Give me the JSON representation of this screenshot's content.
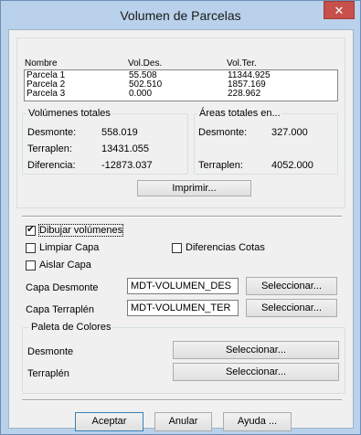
{
  "window": {
    "title": "Volumen de Parcelas",
    "close_glyph": "✕"
  },
  "table": {
    "headers": [
      "Nombre",
      "Vol.Des.",
      "Vol.Ter."
    ],
    "rows": [
      [
        "Parcela 1",
        "55.508",
        "11344.925"
      ],
      [
        "Parcela 2",
        "502.510",
        "1857.169"
      ],
      [
        "Parcela 3",
        "0.000",
        "228.962"
      ]
    ]
  },
  "volumes": {
    "title": "Volúmenes totales",
    "desmonte_label": "Desmonte:",
    "desmonte_value": "558.019",
    "terraplen_label": "Terraplen:",
    "terraplen_value": "13431.055",
    "diferencia_label": "Diferencia:",
    "diferencia_value": "-12873.037"
  },
  "areas": {
    "title": "Áreas totales en...",
    "desmonte_label": "Desmonte:",
    "desmonte_value": "327.000",
    "terraplen_label": "Terraplen:",
    "terraplen_value": "4052.000"
  },
  "imprimir_label": "Imprimir...",
  "options": {
    "dibujar": {
      "label": "Dibujar volúmenes",
      "checked": true
    },
    "limpiar": {
      "label": "Limpiar Capa",
      "checked": false
    },
    "diferencias": {
      "label": "Diferencias Cotas",
      "checked": false
    },
    "aislar": {
      "label": "Aislar Capa",
      "checked": false
    }
  },
  "capa_desmonte": {
    "label": "Capa Desmonte",
    "value": "MDT-VOLUMEN_DES",
    "button": "Seleccionar..."
  },
  "capa_terraplen": {
    "label": "Capa Terraplén",
    "value": "MDT-VOLUMEN_TER",
    "button": "Seleccionar..."
  },
  "paleta": {
    "title": "Paleta de Colores",
    "desmonte_label": "Desmonte",
    "desmonte_button": "Seleccionar...",
    "terraplen_label": "Terraplén",
    "terraplen_button": "Seleccionar..."
  },
  "footer": {
    "aceptar": "Aceptar",
    "anular": "Anular",
    "ayuda": "Ayuda ..."
  }
}
